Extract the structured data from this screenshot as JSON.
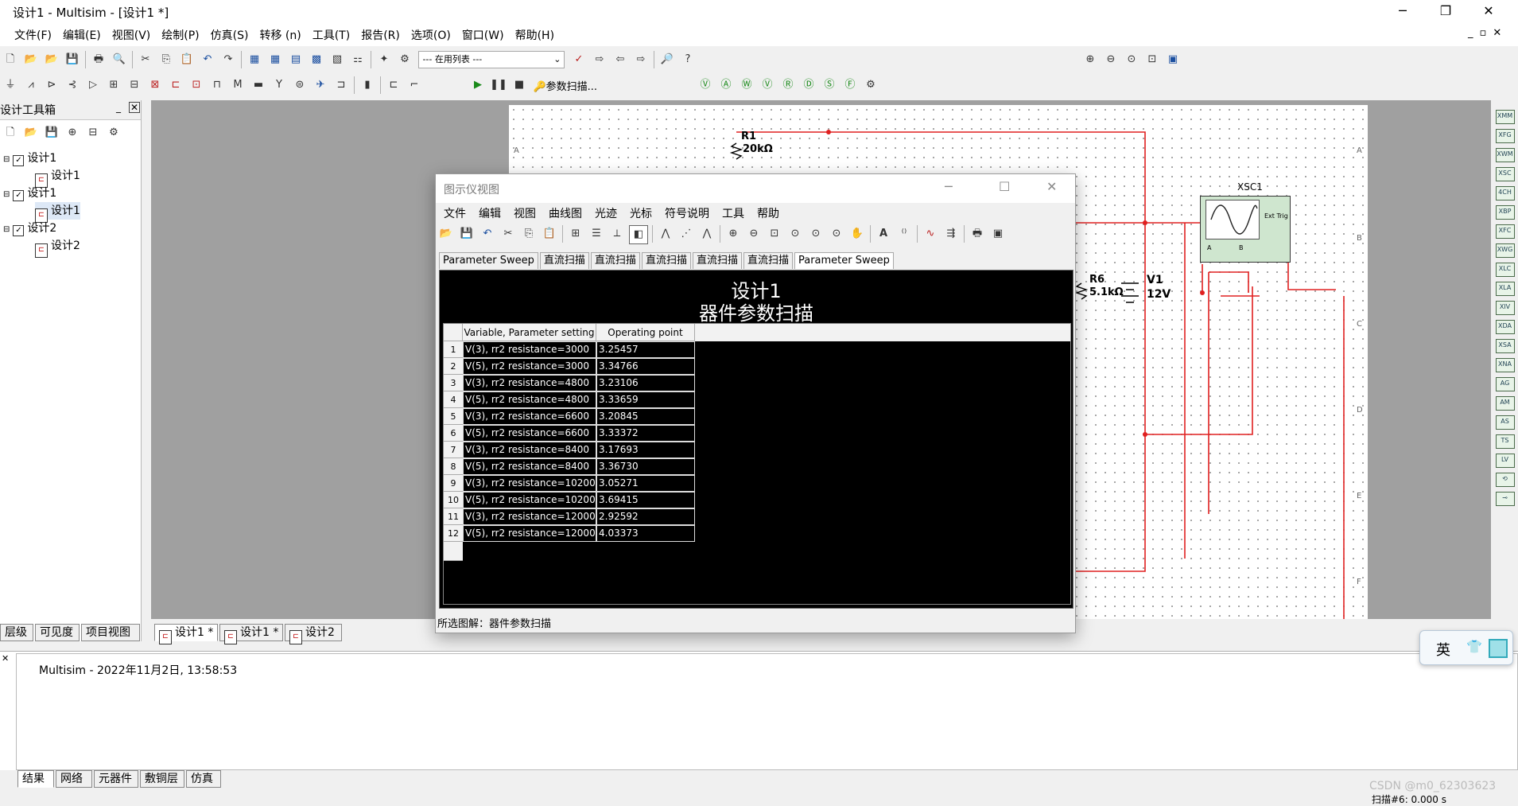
{
  "window": {
    "title": "设计1 - Multisim - [设计1 *]",
    "controls": {
      "minimize": "─",
      "restore": "❐",
      "close": "✕"
    },
    "mdi_controls": [
      "_",
      "▫",
      "✕"
    ]
  },
  "menubar": [
    "文件(F)",
    "编辑(E)",
    "视图(V)",
    "绘制(P)",
    "仿真(S)",
    "转移 (n)",
    "工具(T)",
    "报告(R)",
    "选项(O)",
    "窗口(W)",
    "帮助(H)"
  ],
  "toolbar": {
    "in_use_list": "--- 在用列表 ---",
    "param_sweep": "参数扫描..."
  },
  "toolbox": {
    "title": "设计工具箱",
    "tree": [
      {
        "label": "设计1",
        "child": "设计1"
      },
      {
        "label": "设计1",
        "child": "设计1"
      },
      {
        "label": "设计2",
        "child": "设计2"
      }
    ],
    "tabs": [
      "层级",
      "可见度",
      "项目视图"
    ]
  },
  "sheet_tabs": [
    "设计1 *",
    "设计1 *",
    "设计2"
  ],
  "schematic": {
    "r1_name": "R1",
    "r1_value": "20kΩ",
    "r6_name": "R6",
    "r6_value": "5.1kΩ",
    "v1_name": "V1",
    "v1_value": "12V",
    "scope_name": "XSC1",
    "scope_trig": "Ext Trig",
    "scope_a": "A",
    "scope_b": "B",
    "border_letters": [
      "A",
      "B",
      "C",
      "D",
      "E",
      "F"
    ]
  },
  "grapher": {
    "title": "图示仪视图",
    "menus": [
      "文件",
      "编辑",
      "视图",
      "曲线图",
      "光迹",
      "光标",
      "符号说明",
      "工具",
      "帮助"
    ],
    "tabs": [
      "Parameter Sweep",
      "直流扫描",
      "直流扫描",
      "直流扫描",
      "直流扫描",
      "直流扫描",
      "Parameter Sweep"
    ],
    "plot_title_1": "设计1",
    "plot_title_2": "器件参数扫描",
    "col_variable": "Variable, Parameter setting",
    "col_value": "Operating point value",
    "rows": [
      {
        "n": "1",
        "var": "V(3), rr2 resistance=3000",
        "val": "3.25457"
      },
      {
        "n": "2",
        "var": "V(5), rr2 resistance=3000",
        "val": "3.34766"
      },
      {
        "n": "3",
        "var": "V(3), rr2 resistance=4800",
        "val": "3.23106"
      },
      {
        "n": "4",
        "var": "V(5), rr2 resistance=4800",
        "val": "3.33659"
      },
      {
        "n": "5",
        "var": "V(3), rr2 resistance=6600",
        "val": "3.20845"
      },
      {
        "n": "6",
        "var": "V(5), rr2 resistance=6600",
        "val": "3.33372"
      },
      {
        "n": "7",
        "var": "V(3), rr2 resistance=8400",
        "val": "3.17693"
      },
      {
        "n": "8",
        "var": "V(5), rr2 resistance=8400",
        "val": "3.36730"
      },
      {
        "n": "9",
        "var": "V(3), rr2 resistance=10200",
        "val": "3.05271"
      },
      {
        "n": "10",
        "var": "V(5), rr2 resistance=10200",
        "val": "3.69415"
      },
      {
        "n": "11",
        "var": "V(3), rr2 resistance=12000",
        "val": "2.92592"
      },
      {
        "n": "12",
        "var": "V(5), rr2 resistance=12000",
        "val": "4.03373"
      }
    ],
    "status": "所选图解：器件参数扫描"
  },
  "output": {
    "message": "Multisim  -  2022年11月2日, 13:58:53",
    "tabs": [
      "结果",
      "网络",
      "元器件",
      "敷铜层",
      "仿真"
    ]
  },
  "statusbar": {
    "watermark": "CSDN @m0_62303623",
    "sweep": "扫描#6: 0.000 s"
  },
  "ime": {
    "lang": "英"
  }
}
